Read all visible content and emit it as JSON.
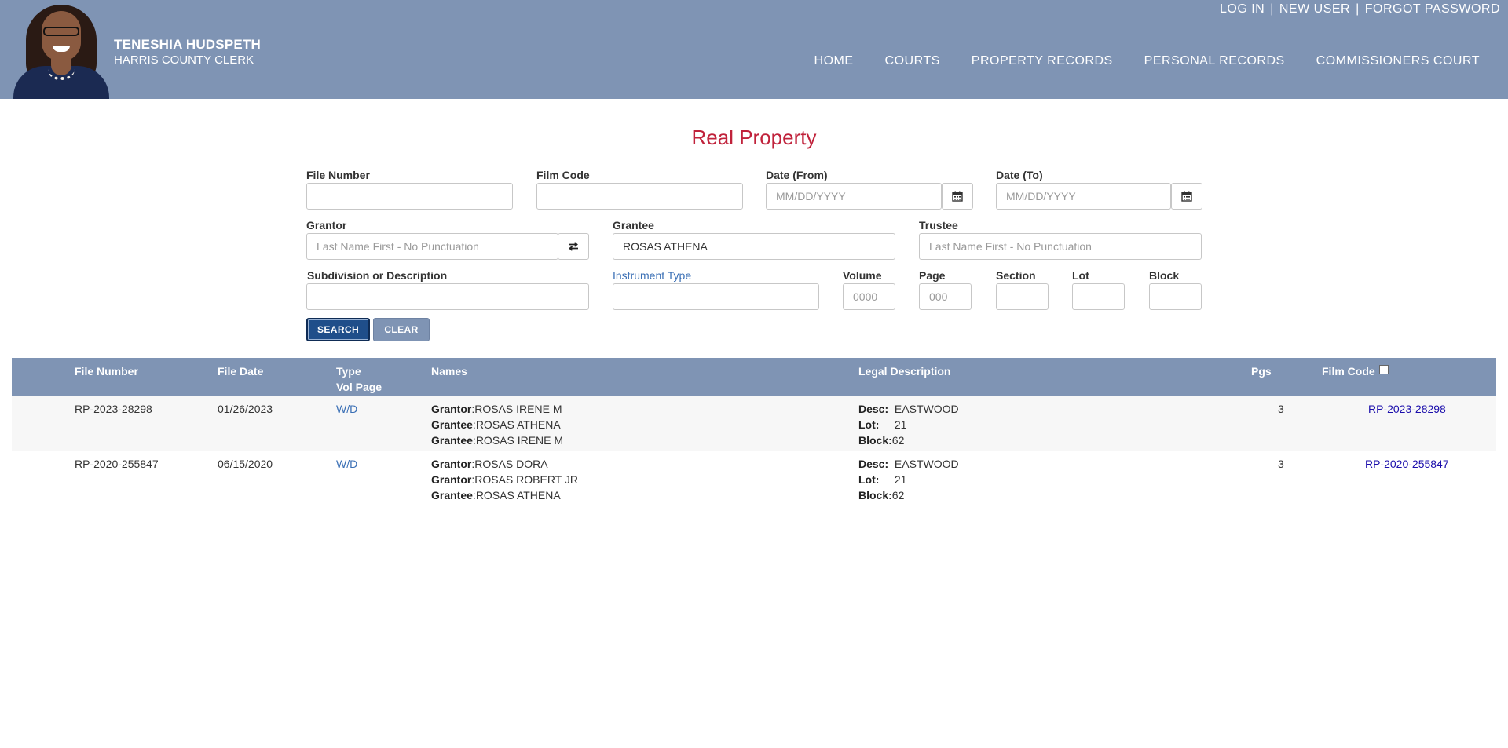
{
  "header": {
    "clerk_name": "TENESHIA HUDSPETH",
    "clerk_title": "HARRIS COUNTY CLERK",
    "account_links": [
      "LOG IN",
      "NEW USER",
      "FORGOT PASSWORD"
    ],
    "nav": [
      "HOME",
      "COURTS",
      "PROPERTY RECORDS",
      "PERSONAL RECORDS",
      "COMMISSIONERS COURT"
    ]
  },
  "form": {
    "title": "Real Property",
    "file_number": {
      "label": "File Number",
      "value": ""
    },
    "film_code": {
      "label": "Film Code",
      "value": ""
    },
    "date_from": {
      "label": "Date (From)",
      "placeholder": "MM/DD/YYYY"
    },
    "date_to": {
      "label": "Date (To)",
      "placeholder": "MM/DD/YYYY"
    },
    "grantor": {
      "label": "Grantor",
      "placeholder": "Last Name First - No Punctuation"
    },
    "grantee": {
      "label": "Grantee",
      "value": "ROSAS ATHENA"
    },
    "trustee": {
      "label": "Trustee",
      "placeholder": "Last Name First - No Punctuation"
    },
    "subdivision": {
      "label": "Subdivision or Description",
      "value": ""
    },
    "instrument_type": {
      "label": "Instrument Type",
      "value": ""
    },
    "volume": {
      "label": "Volume",
      "placeholder": "0000"
    },
    "page": {
      "label": "Page",
      "placeholder": "000"
    },
    "section": {
      "label": "Section"
    },
    "lot": {
      "label": "Lot"
    },
    "block": {
      "label": "Block"
    },
    "search_label": "SEARCH",
    "clear_label": "CLEAR"
  },
  "results": {
    "columns": {
      "file_number": "File Number",
      "file_date": "File Date",
      "type": "Type",
      "vol_page": "Vol Page",
      "names": "Names",
      "legal": "Legal Description",
      "pgs": "Pgs",
      "film_code": "Film Code"
    },
    "labels": {
      "grantor": "Grantor",
      "grantee": "Grantee",
      "desc": "Desc:",
      "lot": "Lot:",
      "block": "Block:"
    },
    "rows": [
      {
        "file_number": "RP-2023-28298",
        "file_date": "01/26/2023",
        "type": "W/D",
        "names": [
          {
            "role": "Grantor",
            "name": "ROSAS IRENE M"
          },
          {
            "role": "Grantee",
            "name": "ROSAS ATHENA"
          },
          {
            "role": "Grantee",
            "name": "ROSAS IRENE M"
          }
        ],
        "desc": "EASTWOOD",
        "lot": "21",
        "block": "62",
        "pgs": "3",
        "film_code": "RP-2023-28298"
      },
      {
        "file_number": "RP-2020-255847",
        "file_date": "06/15/2020",
        "type": "W/D",
        "names": [
          {
            "role": "Grantor",
            "name": "ROSAS DORA"
          },
          {
            "role": "Grantor",
            "name": "ROSAS ROBERT JR"
          },
          {
            "role": "Grantee",
            "name": "ROSAS ATHENA"
          }
        ],
        "desc": "EASTWOOD",
        "lot": "21",
        "block": "62",
        "pgs": "3",
        "film_code": "RP-2020-255847"
      }
    ]
  },
  "colors": {
    "header_bg": "#7f94b4",
    "title_red": "#c0223b",
    "search_btn": "#1f4e8a",
    "link_blue": "#3a6fb5"
  },
  "icons": [
    "calendar-icon",
    "swap-icon"
  ]
}
